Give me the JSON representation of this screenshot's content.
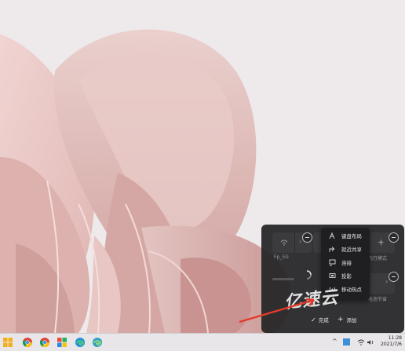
{
  "quick_settings": {
    "tiles": [
      {
        "label": "Fp_5G"
      },
      {
        "label": "飞行模式"
      },
      {
        "label": "电池节省"
      }
    ],
    "add_menu": {
      "items": [
        {
          "label": "键盘布局",
          "icon": "keyboard-layout-icon"
        },
        {
          "label": "就近共享",
          "icon": "nearby-share-icon"
        },
        {
          "label": "连接",
          "icon": "cast-connect-icon"
        },
        {
          "label": "投影",
          "icon": "project-icon"
        },
        {
          "label": "移动热点",
          "icon": "mobile-hotspot-icon"
        }
      ]
    },
    "done_label": "完成",
    "add_label": "添加"
  },
  "watermark": {
    "text": "亿速云"
  },
  "taskbar": {
    "apps": [
      "start-icon",
      "chrome-icon",
      "chrome-icon",
      "store-icon",
      "edge-icon",
      "edge-icon"
    ],
    "clock_time": "11:28",
    "clock_date": "2021/7/6"
  },
  "colors": {
    "panel_bg": "#262628",
    "menu_bg": "#1f1f21",
    "accent_blue": "#3c8fd8",
    "annotation_arrow": "#e23a2a",
    "taskbar_bg": "#e8e6e8"
  }
}
